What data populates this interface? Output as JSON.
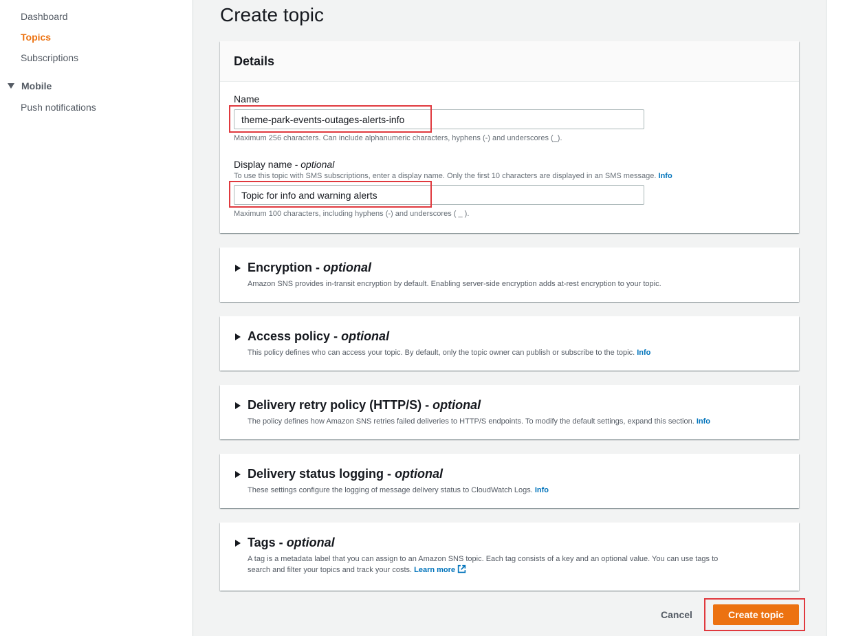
{
  "sidebar": {
    "items": [
      {
        "label": "Dashboard"
      },
      {
        "label": "Topics"
      },
      {
        "label": "Subscriptions"
      }
    ],
    "section": {
      "label": "Mobile"
    },
    "section_items": [
      {
        "label": "Push notifications"
      }
    ]
  },
  "page": {
    "title": "Create topic"
  },
  "details": {
    "header": "Details",
    "name_label": "Name",
    "name_value": "theme-park-events-outages-alerts-info",
    "name_hint": "Maximum 256 characters. Can include alphanumeric characters, hyphens (-) and underscores (_).",
    "display_label": "Display name - ",
    "display_optional": "optional",
    "display_desc": "To use this topic with SMS subscriptions, enter a display name. Only the first 10 characters are displayed in an SMS message.",
    "display_info": "Info",
    "display_value": "Topic for info and warning alerts",
    "display_hint": "Maximum 100 characters, including hyphens (-) and underscores ( _ )."
  },
  "sections": [
    {
      "title": "Encryption - ",
      "optional": "optional",
      "desc": "Amazon SNS provides in-transit encryption by default. Enabling server-side encryption adds at-rest encryption to your topic."
    },
    {
      "title": "Access policy - ",
      "optional": "optional",
      "desc": "This policy defines who can access your topic. By default, only the topic owner can publish or subscribe to the topic.",
      "info": "Info"
    },
    {
      "title": "Delivery retry policy (HTTP/S) - ",
      "optional": "optional",
      "desc": "The policy defines how Amazon SNS retries failed deliveries to HTTP/S endpoints. To modify the default settings, expand this section.",
      "info": "Info"
    },
    {
      "title": "Delivery status logging - ",
      "optional": "optional",
      "desc": "These settings configure the logging of message delivery status to CloudWatch Logs.",
      "info": "Info"
    },
    {
      "title": "Tags - ",
      "optional": "optional",
      "desc_line1": "A tag is a metadata label that you can assign to an Amazon SNS topic. Each tag consists of a key and an optional value. You can use tags to",
      "desc_line2": "search and filter your topics and track your costs.",
      "learn_more": "Learn more"
    }
  ],
  "actions": {
    "cancel": "Cancel",
    "create": "Create topic"
  },
  "colors": {
    "accent": "#ec7211",
    "link": "#0073bb",
    "annotation": "#e0393e",
    "background": "#f2f3f3"
  },
  "icons": {
    "collapse": "caret-down-icon",
    "expand": "caret-right-icon",
    "external": "external-link-icon"
  }
}
